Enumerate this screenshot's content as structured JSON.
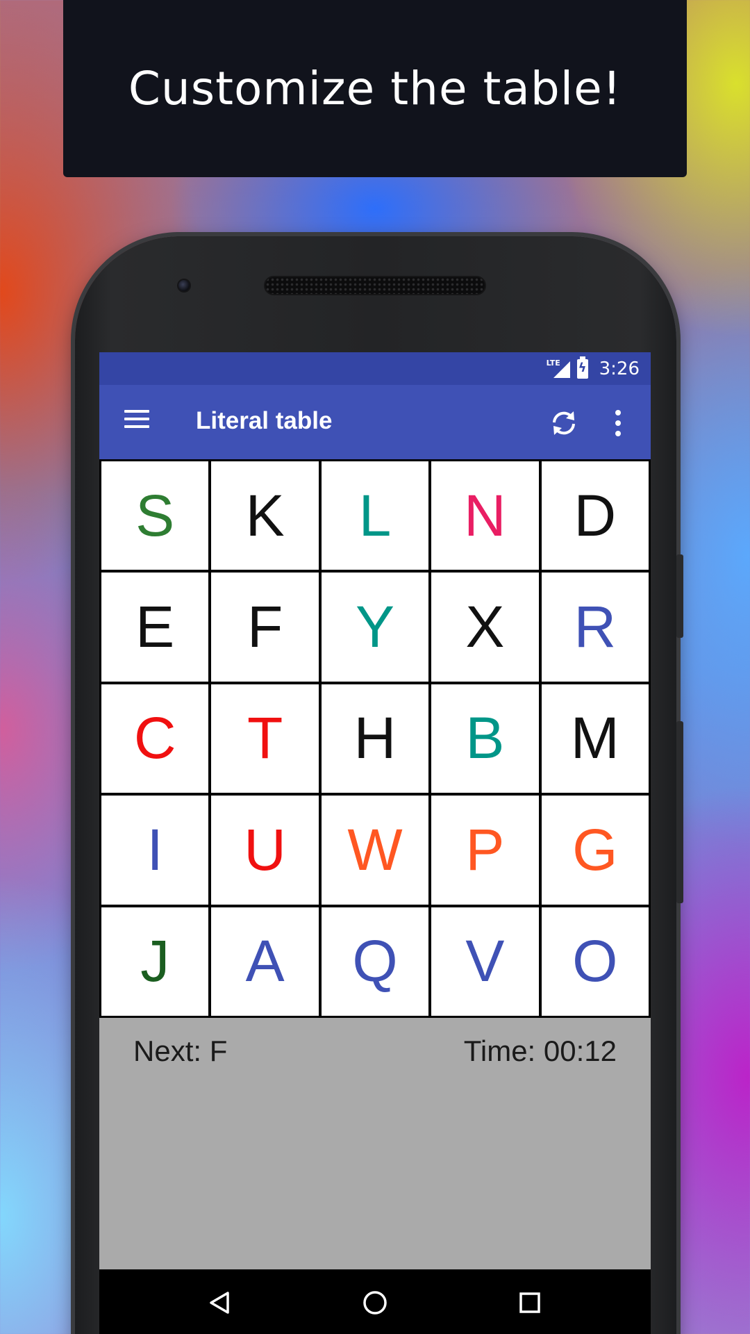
{
  "banner": {
    "text": "Customize the table!"
  },
  "statusbar": {
    "network": "LTE",
    "time": "3:26"
  },
  "appbar": {
    "title": "Literal table",
    "icons": [
      "menu-icon",
      "refresh-icon",
      "more-vert-icon"
    ]
  },
  "table": {
    "rows": [
      [
        {
          "letter": "S",
          "color": "#2e7d32"
        },
        {
          "letter": "K",
          "color": "#111111"
        },
        {
          "letter": "L",
          "color": "#009688"
        },
        {
          "letter": "N",
          "color": "#e91e63"
        },
        {
          "letter": "D",
          "color": "#111111"
        }
      ],
      [
        {
          "letter": "E",
          "color": "#111111"
        },
        {
          "letter": "F",
          "color": "#111111"
        },
        {
          "letter": "Y",
          "color": "#009688"
        },
        {
          "letter": "X",
          "color": "#111111"
        },
        {
          "letter": "R",
          "color": "#3f51b5"
        }
      ],
      [
        {
          "letter": "C",
          "color": "#f01010"
        },
        {
          "letter": "T",
          "color": "#f01010"
        },
        {
          "letter": "H",
          "color": "#111111"
        },
        {
          "letter": "B",
          "color": "#009688"
        },
        {
          "letter": "M",
          "color": "#111111"
        }
      ],
      [
        {
          "letter": "I",
          "color": "#3f51b5"
        },
        {
          "letter": "U",
          "color": "#f01010"
        },
        {
          "letter": "W",
          "color": "#ff5722"
        },
        {
          "letter": "P",
          "color": "#ff5722"
        },
        {
          "letter": "G",
          "color": "#ff5722"
        }
      ],
      [
        {
          "letter": "J",
          "color": "#1b5e20"
        },
        {
          "letter": "A",
          "color": "#3f51b5"
        },
        {
          "letter": "Q",
          "color": "#3f51b5"
        },
        {
          "letter": "V",
          "color": "#3f51b5"
        },
        {
          "letter": "O",
          "color": "#3f51b5"
        }
      ]
    ]
  },
  "info": {
    "next": "Next: F",
    "time": "Time: 00:12"
  },
  "navbar": {
    "icons": [
      "back-icon",
      "home-icon",
      "recents-icon"
    ]
  }
}
